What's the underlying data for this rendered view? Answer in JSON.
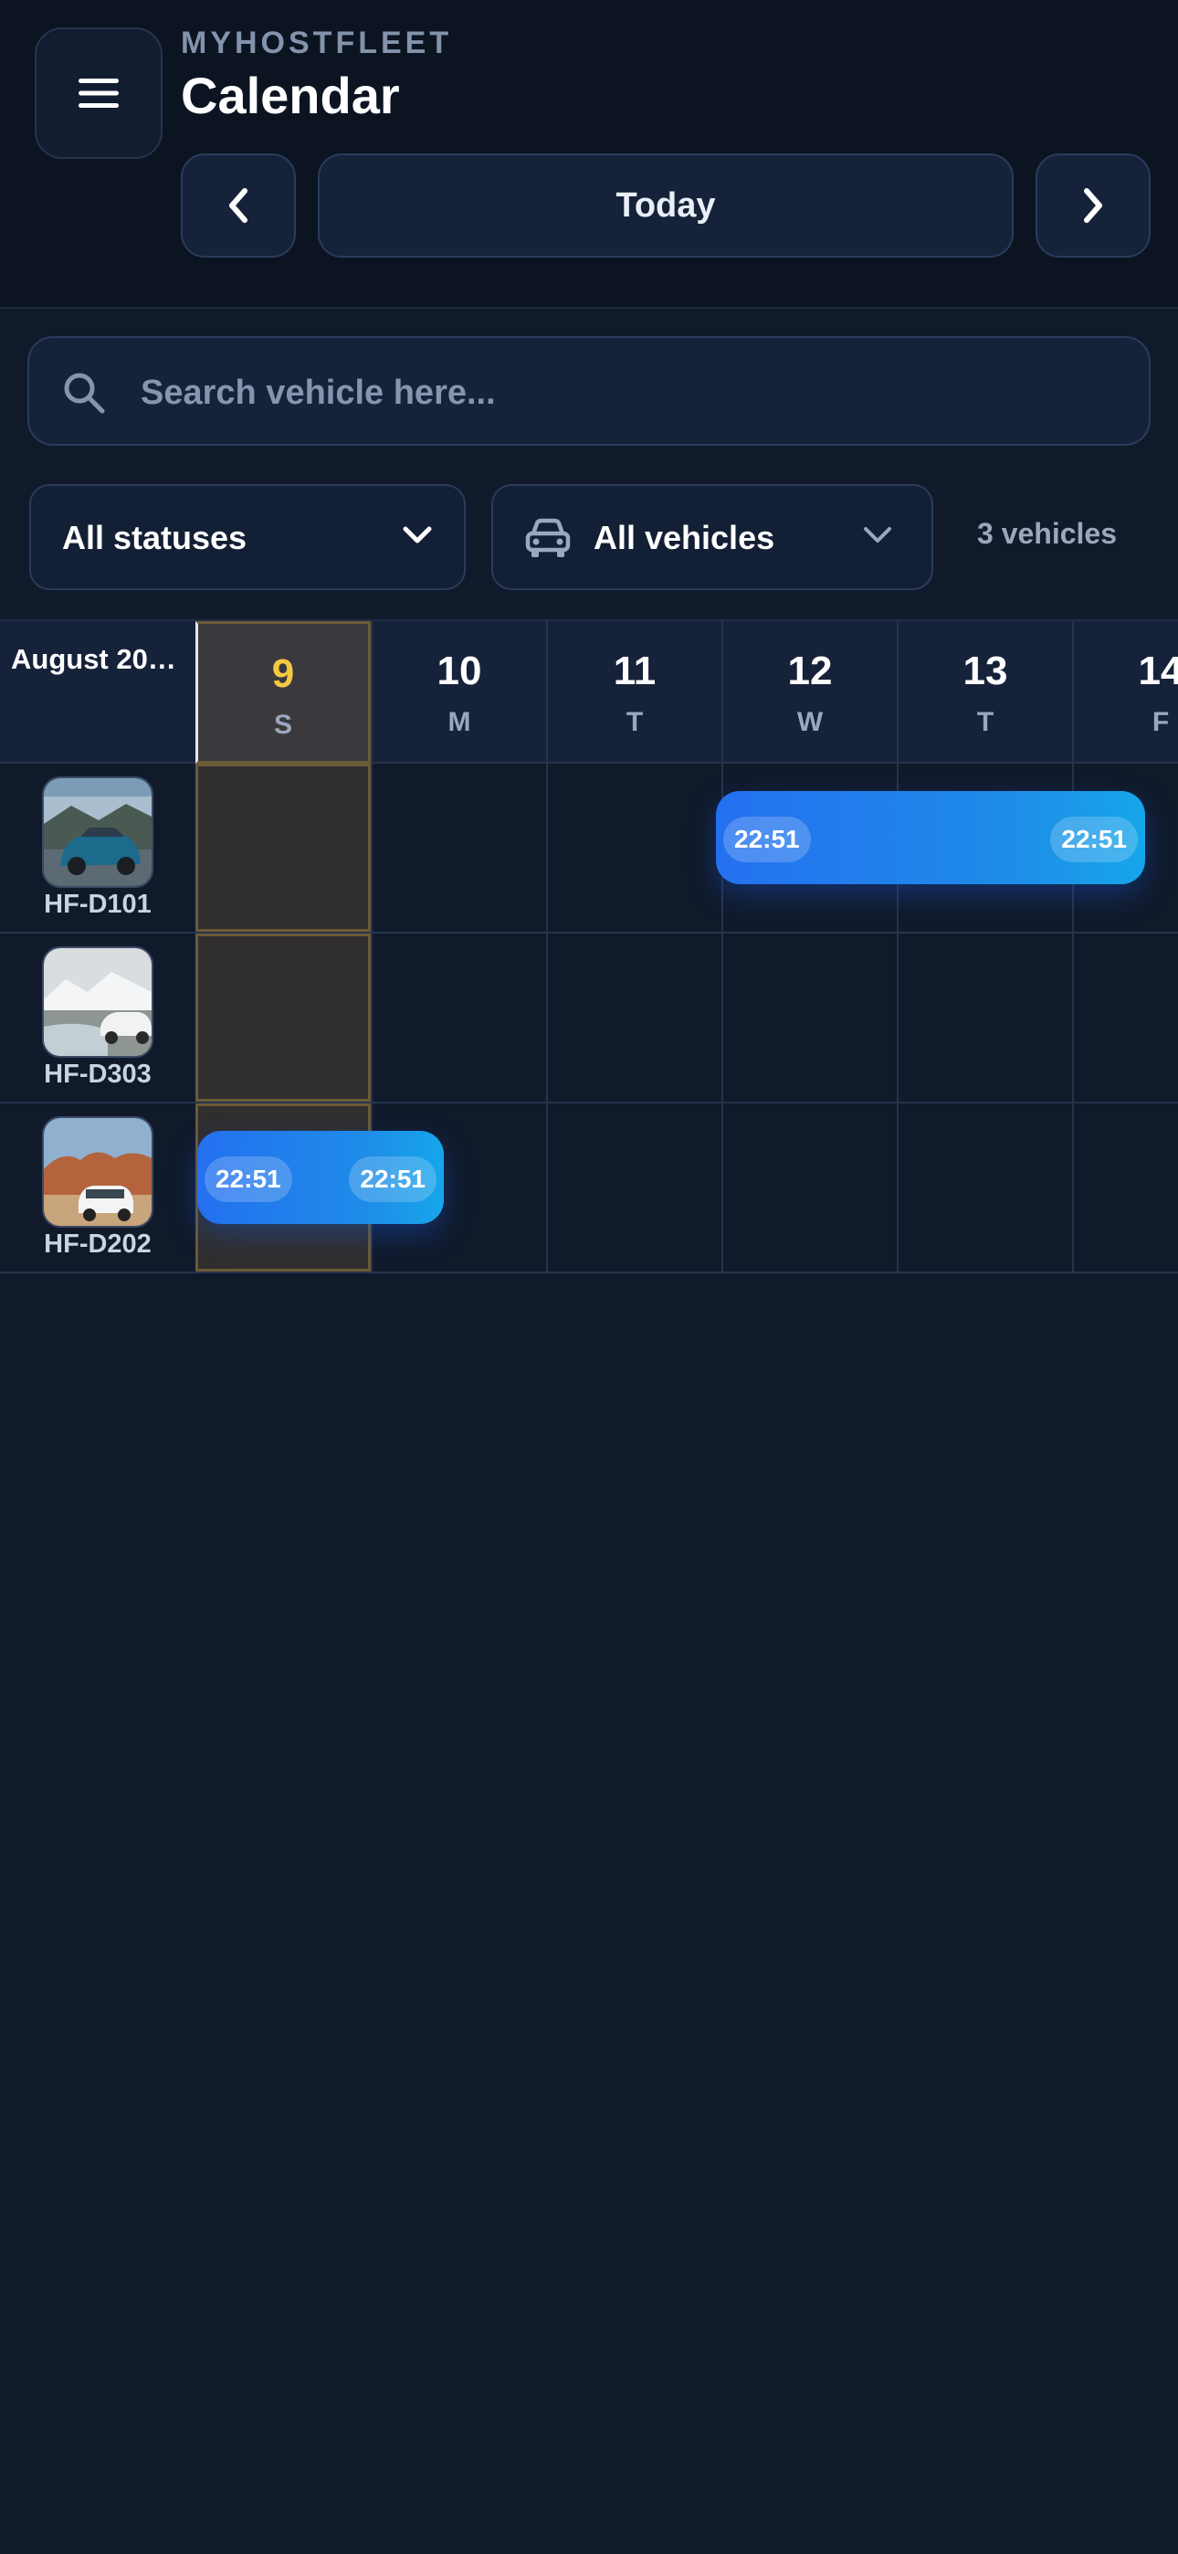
{
  "header": {
    "brand": "MYHOSTFLEET",
    "title": "Calendar",
    "today_label": "Today"
  },
  "search": {
    "placeholder": "Search vehicle here..."
  },
  "filters": {
    "status_label": "All statuses",
    "vehicle_label": "All vehicles",
    "vehicle_count": "3 vehicles"
  },
  "calendar": {
    "month_label": "August 20…",
    "days": [
      {
        "num": "9",
        "letter": "S"
      },
      {
        "num": "10",
        "letter": "M"
      },
      {
        "num": "11",
        "letter": "T"
      },
      {
        "num": "12",
        "letter": "W"
      },
      {
        "num": "13",
        "letter": "T"
      },
      {
        "num": "14",
        "letter": "F"
      }
    ],
    "vehicles": [
      {
        "plate": "HF-D101"
      },
      {
        "plate": "HF-D303"
      },
      {
        "plate": "HF-D202"
      }
    ],
    "bookings": [
      {
        "vehicle": "HF-D101",
        "start_time": "22:51",
        "end_time": "22:51"
      },
      {
        "vehicle": "HF-D202",
        "start_time": "22:51",
        "end_time": "22:51"
      }
    ]
  },
  "colors": {
    "background": "#111a2b",
    "today_accent": "#f5c842",
    "booking_blue": "#2470f0"
  }
}
